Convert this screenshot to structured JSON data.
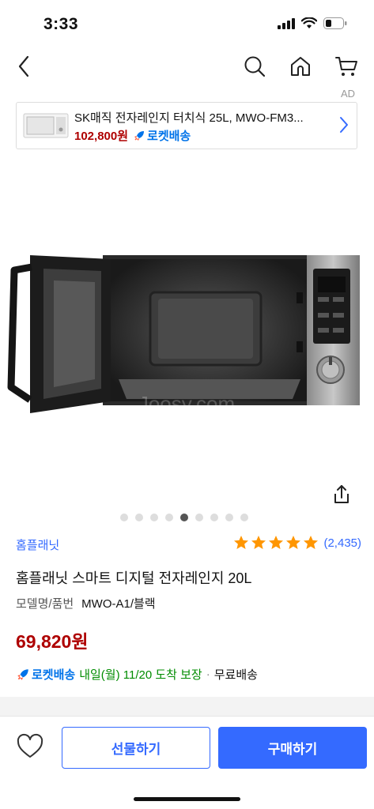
{
  "status_bar": {
    "time": "3:33"
  },
  "ad": {
    "label": "AD",
    "title": "SK매직 전자레인지 터치식 25L, MWO-FM3...",
    "price": "102,800원",
    "rocket_label": "로켓배송"
  },
  "gallery": {
    "watermark": "Joosy.com",
    "dots_count": 9,
    "active_index": 4
  },
  "product": {
    "brand": "홈플래닛",
    "rating": {
      "stars": 5,
      "count": "(2,435)"
    },
    "title": "홈플래닛 스마트 디지털 전자레인지 20L",
    "model_label": "모델명/품번",
    "model_value": "MWO-A1/블랙",
    "price": "69,820원"
  },
  "delivery": {
    "rocket_label": "로켓배송",
    "date_text": "내일(월) 11/20 도착 보장",
    "separator": "·",
    "free_text": "무료배송"
  },
  "bottom_bar": {
    "gift_label": "선물하기",
    "buy_label": "구매하기"
  },
  "colors": {
    "accent_blue": "#346aff",
    "price_red": "#ae0000",
    "rocket_blue": "#0073e9",
    "delivery_green": "#008c00",
    "star": "#ff9600"
  }
}
